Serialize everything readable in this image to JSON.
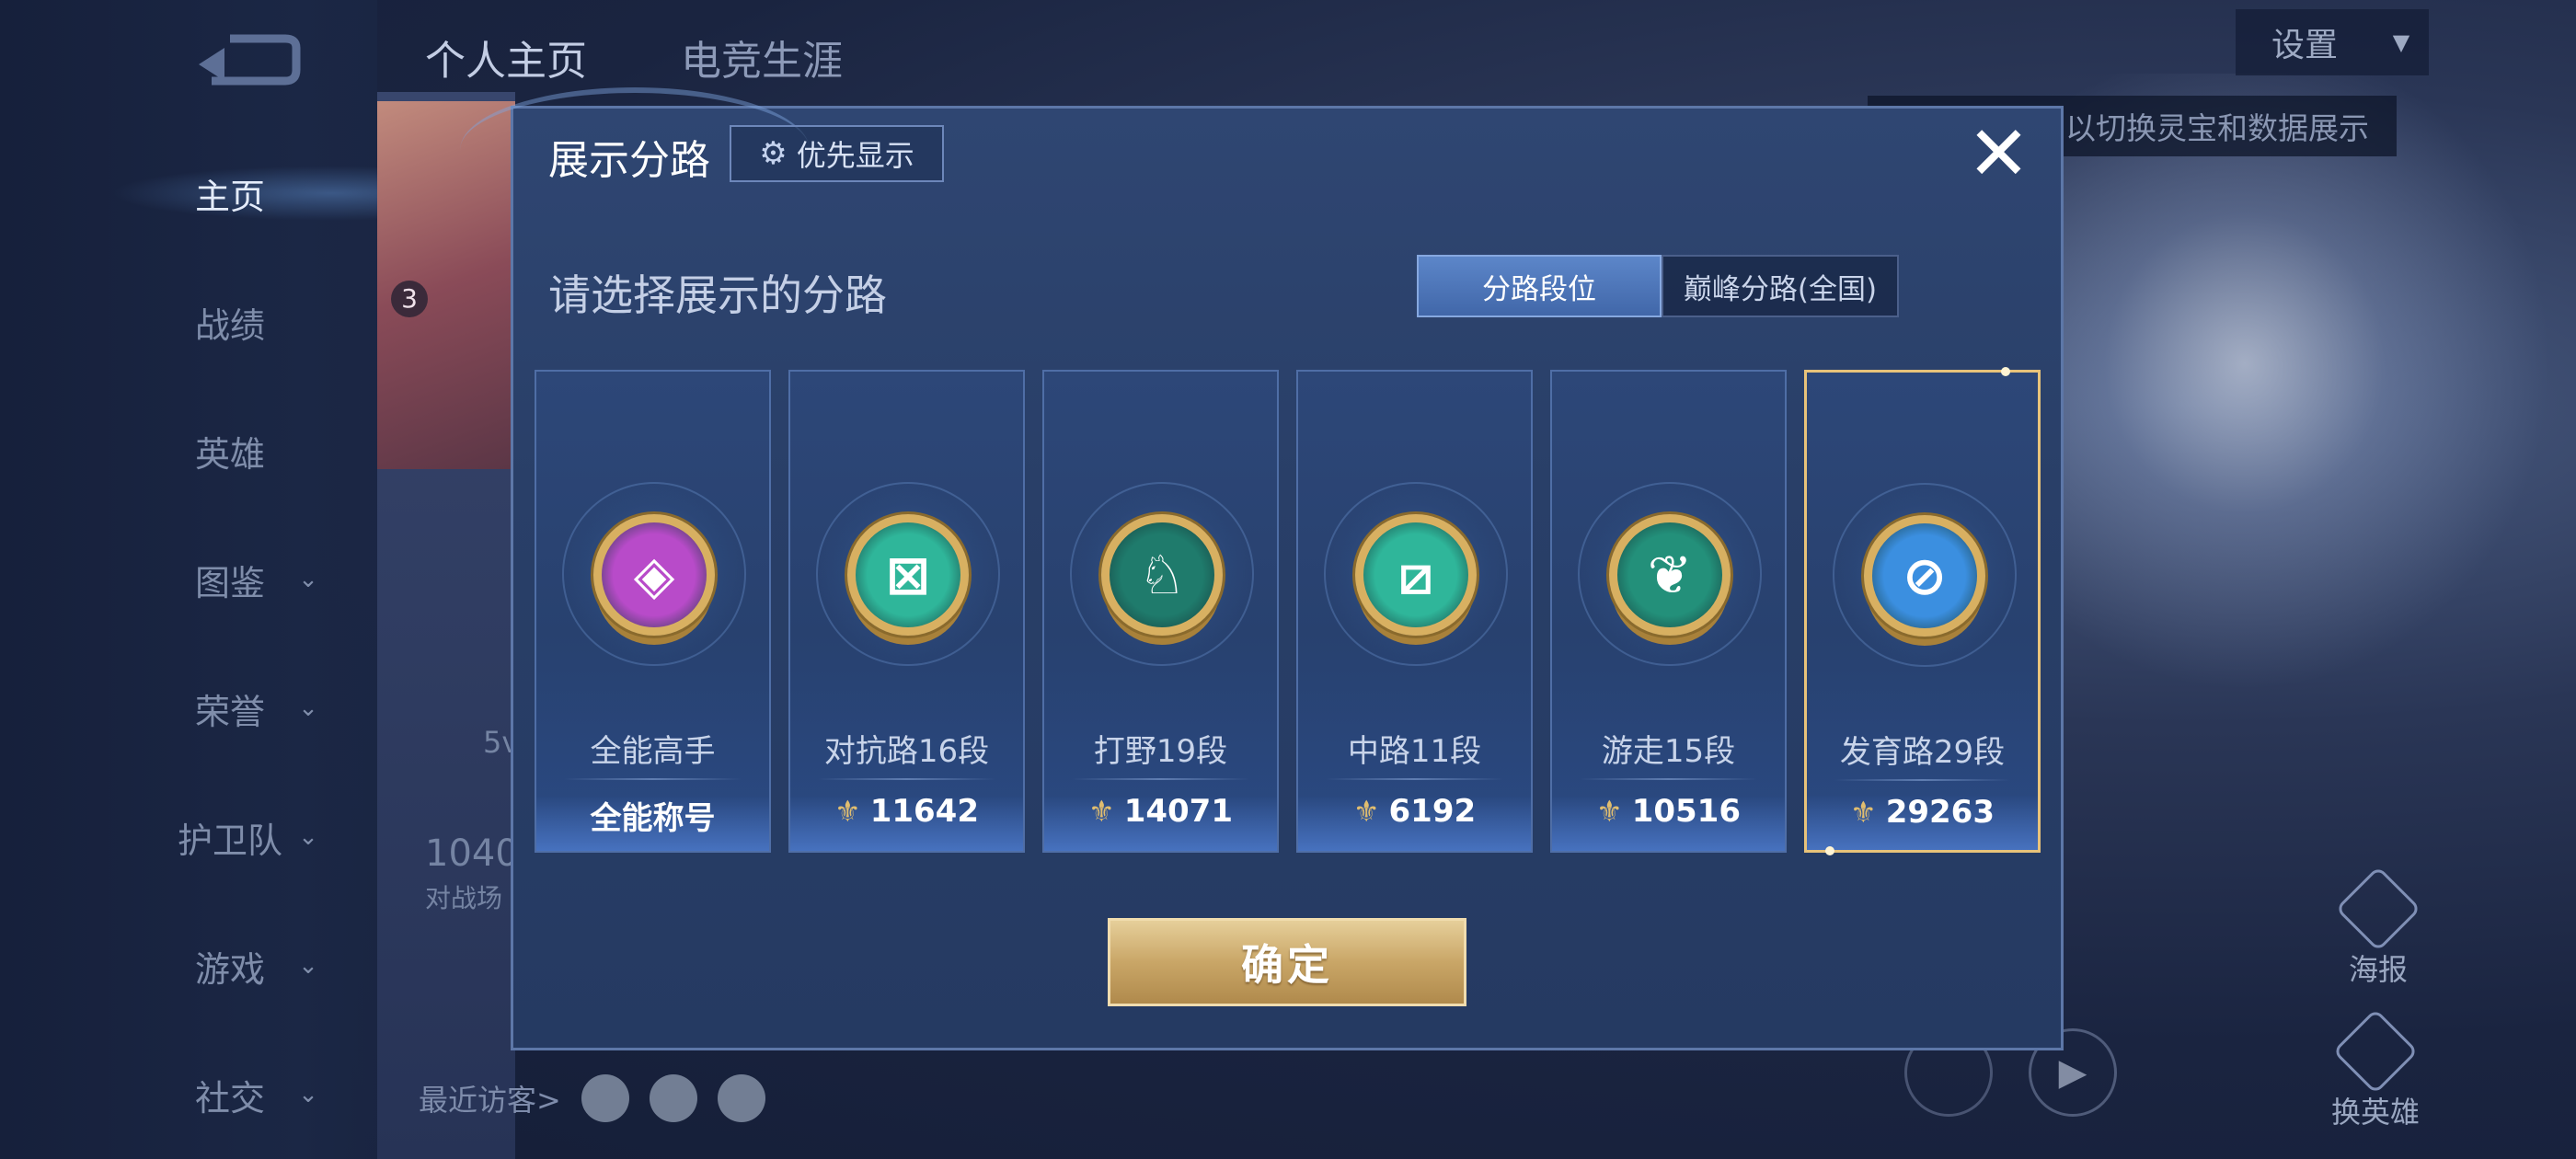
{
  "sidebar": {
    "items": [
      {
        "label": "主页",
        "has_chevron": false,
        "active": true
      },
      {
        "label": "战绩",
        "has_chevron": false
      },
      {
        "label": "英雄",
        "has_chevron": false
      },
      {
        "label": "图鉴",
        "has_chevron": true
      },
      {
        "label": "荣誉",
        "has_chevron": true
      },
      {
        "label": "护卫队",
        "has_chevron": true
      },
      {
        "label": "游戏",
        "has_chevron": true
      },
      {
        "label": "社交",
        "has_chevron": true
      }
    ]
  },
  "header": {
    "tabs": [
      {
        "label": "个人主页",
        "active": true
      },
      {
        "label": "电竞生涯"
      }
    ],
    "settings_label": "设置",
    "tooltip_text": "以切换灵宝和数据展示"
  },
  "background": {
    "count_text": "1040",
    "count_sub": "对战场",
    "level_badge": "3",
    "left_partial": "5v",
    "visitors_label": "最近访客>"
  },
  "right_actions": {
    "poster": "海报",
    "switch_hero": "换英雄"
  },
  "modal": {
    "title": "展示分路",
    "priority_button": "优先显示",
    "subtitle": "请选择展示的分路",
    "segments": [
      {
        "label": "分路段位",
        "active": true
      },
      {
        "label": "巅峰分路(全国)",
        "active": false
      }
    ],
    "cards": [
      {
        "name": "全能高手",
        "value": "全能称号",
        "icon": "all-round-badge-icon",
        "color": "#b84bc9",
        "symbol": "◈",
        "show_points_icon": false,
        "selected": false
      },
      {
        "name": "对抗路16段",
        "value": "11642",
        "icon": "clash-lane-badge-icon",
        "color": "#2fb69a",
        "symbol": "⊠",
        "show_points_icon": true,
        "selected": false
      },
      {
        "name": "打野19段",
        "value": "14071",
        "icon": "jungle-badge-icon",
        "color": "#1f7b6c",
        "symbol": "♘",
        "show_points_icon": true,
        "selected": false
      },
      {
        "name": "中路11段",
        "value": "6192",
        "icon": "mid-lane-badge-icon",
        "color": "#2fb69a",
        "symbol": "⧄",
        "show_points_icon": true,
        "selected": false
      },
      {
        "name": "游走15段",
        "value": "10516",
        "icon": "roam-badge-icon",
        "color": "#23907a",
        "symbol": "❦",
        "show_points_icon": true,
        "selected": false
      },
      {
        "name": "发育路29段",
        "value": "29263",
        "icon": "farm-lane-badge-icon",
        "color": "#3b8fe0",
        "symbol": "⊘",
        "show_points_icon": true,
        "selected": true
      }
    ],
    "confirm_label": "确定"
  }
}
